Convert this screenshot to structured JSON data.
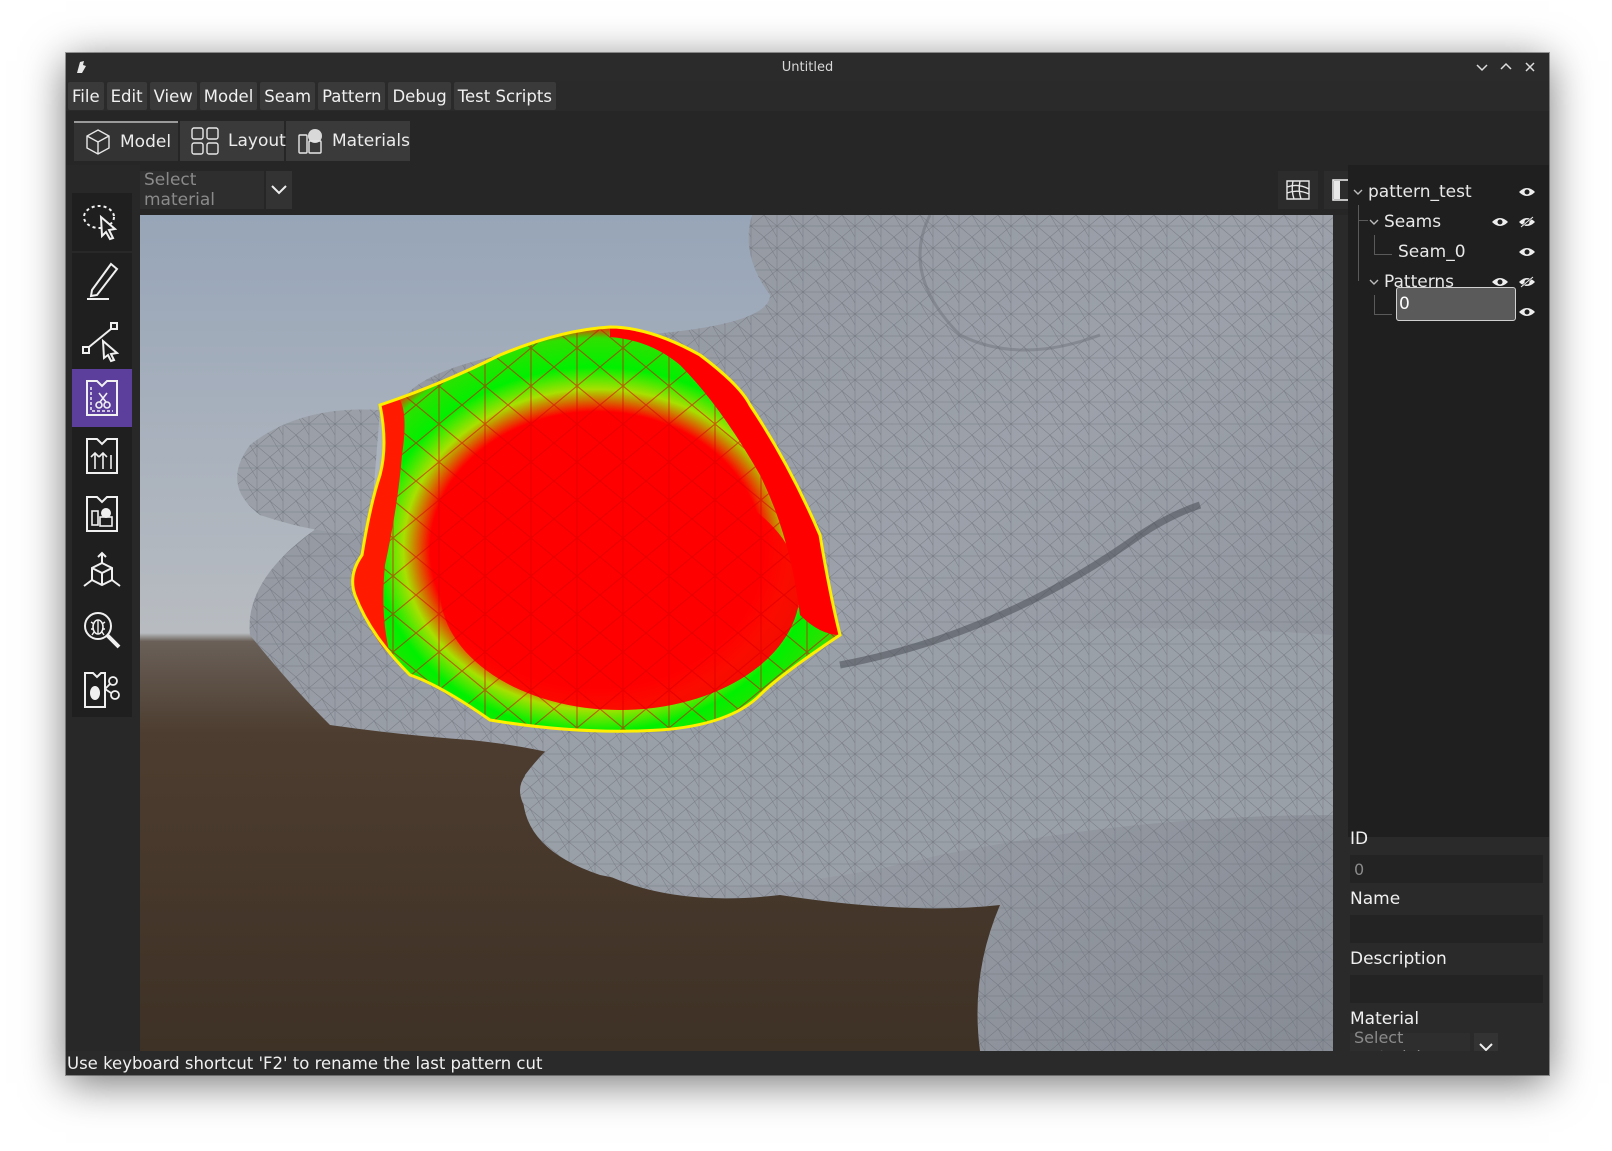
{
  "window": {
    "title": "Untitled"
  },
  "menu": [
    "File",
    "Edit",
    "View",
    "Model",
    "Seam",
    "Pattern",
    "Debug",
    "Test Scripts"
  ],
  "tabs": [
    {
      "label": "Model",
      "active": true,
      "icon": "cube-icon"
    },
    {
      "label": "Layout",
      "active": false,
      "icon": "grid-icon"
    },
    {
      "label": "Materials",
      "active": false,
      "icon": "materials-icon"
    }
  ],
  "tools": [
    {
      "name": "select-tool",
      "icon": "lasso-cursor-icon",
      "active": false
    },
    {
      "name": "draw-tool",
      "icon": "pencil-icon",
      "active": false
    },
    {
      "name": "seam-tool",
      "icon": "path-cursor-icon",
      "active": false
    },
    {
      "name": "pattern-cut-tool",
      "icon": "pattern-scissors-icon",
      "active": true
    },
    {
      "name": "pattern-grain-tool",
      "icon": "pattern-arrows-icon",
      "active": false
    },
    {
      "name": "pattern-material-tool",
      "icon": "pattern-material-icon",
      "active": false
    },
    {
      "name": "transform-tool",
      "icon": "cube-axes-icon",
      "active": false
    },
    {
      "name": "debug-inspect-tool",
      "icon": "bug-magnifier-icon",
      "active": false
    },
    {
      "name": "debug-pattern-tool",
      "icon": "bug-pattern-icon",
      "active": false
    }
  ],
  "viewport": {
    "material_placeholder": "Select material",
    "overlay_colors": {
      "outer": "#ff0000",
      "band": "#00ff00",
      "outline": "#ffee00",
      "mesh": "#8e949f"
    }
  },
  "tree": {
    "root": "pattern_test",
    "seams_group": "Seams",
    "seam_item": "Seam_0",
    "patterns_group": "Patterns",
    "pattern_rename_value": "0"
  },
  "properties": {
    "id_label": "ID",
    "id_value": "0",
    "name_label": "Name",
    "name_value": "",
    "description_label": "Description",
    "description_value": "",
    "material_label": "Material",
    "material_placeholder": "Select material"
  },
  "status": {
    "message": "Use keyboard shortcut 'F2' to rename the last pattern cut"
  }
}
